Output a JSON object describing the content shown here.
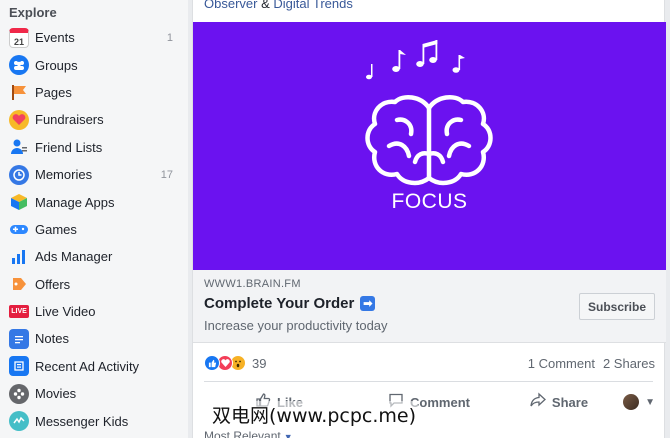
{
  "sidebar": {
    "heading": "Explore",
    "items": [
      {
        "label": "Events",
        "count": "1",
        "icon": "calendar-icon",
        "color": "#f02849"
      },
      {
        "label": "Groups",
        "count": "",
        "icon": "groups-icon",
        "color": "#1877f2"
      },
      {
        "label": "Pages",
        "count": "",
        "icon": "flag-icon",
        "color": "#f7923b"
      },
      {
        "label": "Fundraisers",
        "count": "",
        "icon": "fundraiser-icon",
        "color": "#f3425f"
      },
      {
        "label": "Friend Lists",
        "count": "",
        "icon": "friend-list-icon",
        "color": "#1877f2"
      },
      {
        "label": "Memories",
        "count": "17",
        "icon": "memories-icon",
        "color": "#3578e5"
      },
      {
        "label": "Manage Apps",
        "count": "",
        "icon": "apps-cube-icon",
        "color": "#f7b928"
      },
      {
        "label": "Games",
        "count": "",
        "icon": "gamepad-icon",
        "color": "#2d88ff"
      },
      {
        "label": "Ads Manager",
        "count": "",
        "icon": "ads-chart-icon",
        "color": "#1877f2"
      },
      {
        "label": "Offers",
        "count": "",
        "icon": "offers-icon",
        "color": "#f7923b"
      },
      {
        "label": "Live Video",
        "count": "",
        "icon": "live-video-icon",
        "color": "#e41e3f"
      },
      {
        "label": "Notes",
        "count": "",
        "icon": "notes-icon",
        "color": "#3578e5"
      },
      {
        "label": "Recent Ad Activity",
        "count": "",
        "icon": "ad-activity-icon",
        "color": "#1877f2"
      },
      {
        "label": "Movies",
        "count": "",
        "icon": "film-reel-icon",
        "color": "#65676b"
      },
      {
        "label": "Messenger Kids",
        "count": "",
        "icon": "messenger-kids-icon",
        "color": "#44bec7"
      }
    ]
  },
  "post": {
    "text_part1": "Observer",
    "text_amp": " & ",
    "text_part2": "Digital Trends",
    "image_caption": "FOCUS",
    "image_bg": "#6b12f0",
    "link": {
      "domain": "WWW1.BRAIN.FM",
      "title": "Complete Your Order",
      "title_badge": "➡",
      "description": "Increase your productivity today",
      "cta": "Subscribe"
    },
    "reactions": {
      "count": "39",
      "comments": "1 Comment",
      "shares": "2 Shares"
    },
    "actions": {
      "like": "Like",
      "comment": "Comment",
      "share": "Share"
    },
    "sort": "Most Relevant"
  },
  "watermark": "双电网(www.pcpc.me)"
}
